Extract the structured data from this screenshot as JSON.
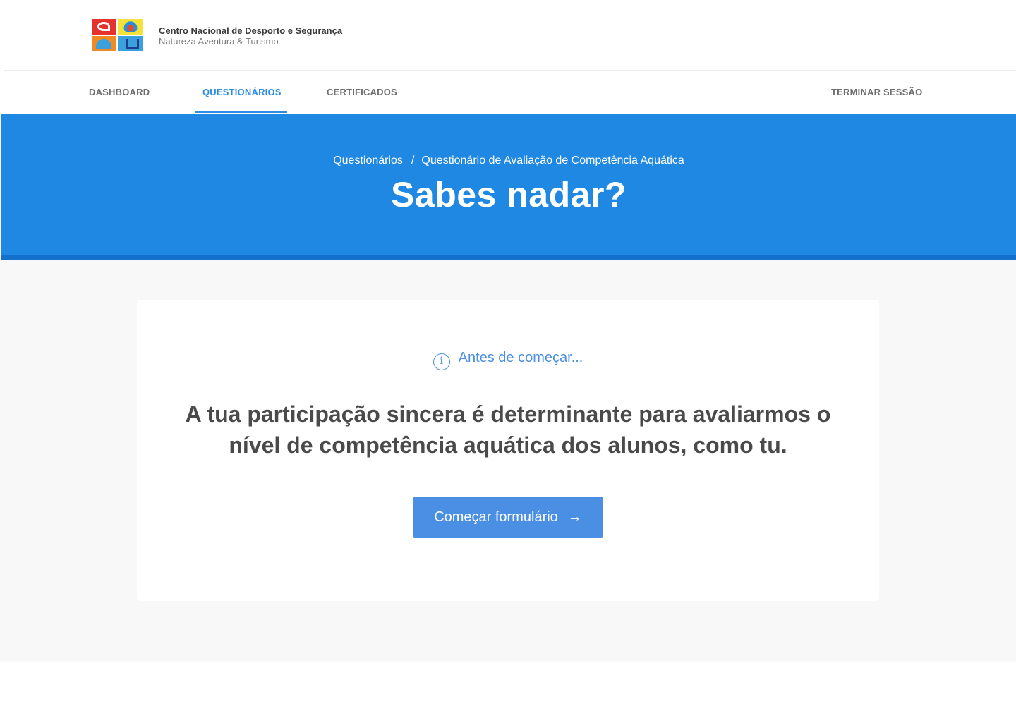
{
  "header": {
    "org_name": "Centro Nacional de Desporto e Segurança",
    "org_subtitle": "Natureza Aventura & Turismo",
    "logo_icon": "organization-logo"
  },
  "nav": {
    "items": [
      {
        "label": "DASHBOARD",
        "active": false
      },
      {
        "label": "QUESTIONÁRIOS",
        "active": true
      },
      {
        "label": "CERTIFICADOS",
        "active": false
      }
    ],
    "logout_label": "TERMINAR SESSÃO"
  },
  "hero": {
    "breadcrumb": {
      "parent": "Questionários",
      "separator": "/",
      "current": "Questionário de Avaliação de Competência Aquática"
    },
    "title": "Sabes nadar?"
  },
  "card": {
    "notice_icon": "i",
    "notice_text": "Antes de começar...",
    "message": "A tua participação sincera é determinante para avaliarmos o nível de competência aquática dos alunos, como tu.",
    "cta_label": "Começar formulário",
    "cta_icon": "→"
  },
  "colors": {
    "primary": "#1f88e3",
    "accent": "#2d8de3",
    "button": "#4a8fe3",
    "text": "#4a4a4a"
  }
}
